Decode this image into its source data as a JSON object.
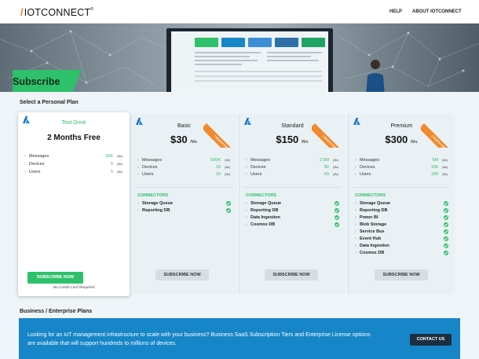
{
  "header": {
    "logo": "IOTCONNECT",
    "logo_mark": "/",
    "logo_tm": "®",
    "nav": [
      "HELP",
      "ABOUT IOTCONNECT"
    ]
  },
  "hero": {
    "banner": "Subscribe"
  },
  "personal": {
    "title": "Select a Personal Plan",
    "connectors_label": "CONNECTORS",
    "free": {
      "name": "Test Drive",
      "price": "2 Months Free",
      "features": [
        {
          "name": "Messages",
          "value": "30K",
          "per": "(Mo)"
        },
        {
          "name": "Devices",
          "value": "5",
          "per": "(Mo)"
        },
        {
          "name": "Users",
          "value": "5",
          "per": "(Mo)"
        }
      ],
      "button": "SUBSCRIBE NOW",
      "note": "No Credit Card Required"
    },
    "plans": [
      {
        "name": "Basic",
        "price": "$30",
        "unit": "/Mo.",
        "ribbon": "1 MONTH FREE",
        "features": [
          {
            "name": "Messages",
            "value": "500K",
            "per": "(Mo)"
          },
          {
            "name": "Devices",
            "value": "10",
            "per": "(Mo)"
          },
          {
            "name": "Users",
            "value": "10",
            "per": "(Mo)"
          }
        ],
        "connectors": [
          "Storage Queue",
          "Reporting DB"
        ],
        "button": "SUBSCRIBE NOW"
      },
      {
        "name": "Standard",
        "price": "$150",
        "unit": "/Mo.",
        "ribbon": "1 MONTH FREE",
        "features": [
          {
            "name": "Messages",
            "value": "2.5M",
            "per": "(Mo)"
          },
          {
            "name": "Devices",
            "value": "50",
            "per": "(Mo)"
          },
          {
            "name": "Users",
            "value": "50",
            "per": "(Mo)"
          }
        ],
        "connectors": [
          "Storage Queue",
          "Reporting DB",
          "Data Ingestion",
          "Cosmos DB"
        ],
        "button": "SUBSCRIBE NOW"
      },
      {
        "name": "Premium",
        "price": "$300",
        "unit": "/Mo.",
        "ribbon": "1 MONTH FREE",
        "features": [
          {
            "name": "Messages",
            "value": "5M",
            "per": "(Mo)"
          },
          {
            "name": "Devices",
            "value": "100",
            "per": "(Mo)"
          },
          {
            "name": "Users",
            "value": "100",
            "per": "(Mo)"
          }
        ],
        "connectors": [
          "Storage Queue",
          "Reporting DB",
          "Power BI",
          "Blob Storage",
          "Service Bus",
          "Event Hub",
          "Data Ingestion",
          "Cosmos DB"
        ],
        "button": "SUBSCRIBE NOW"
      }
    ]
  },
  "enterprise": {
    "title": "Business / Enterprise Plans",
    "text": "Looking for an IoT management infrastructure to scale with your business? Business SaaS Subscription Tiers and Enterprise License options are available that will support hundreds to millions of devices.",
    "button": "CONTACT US"
  },
  "colors": {
    "accent_green": "#2ec06a",
    "ribbon_orange": "#f08a2c",
    "enterprise_blue": "#1686c8"
  }
}
